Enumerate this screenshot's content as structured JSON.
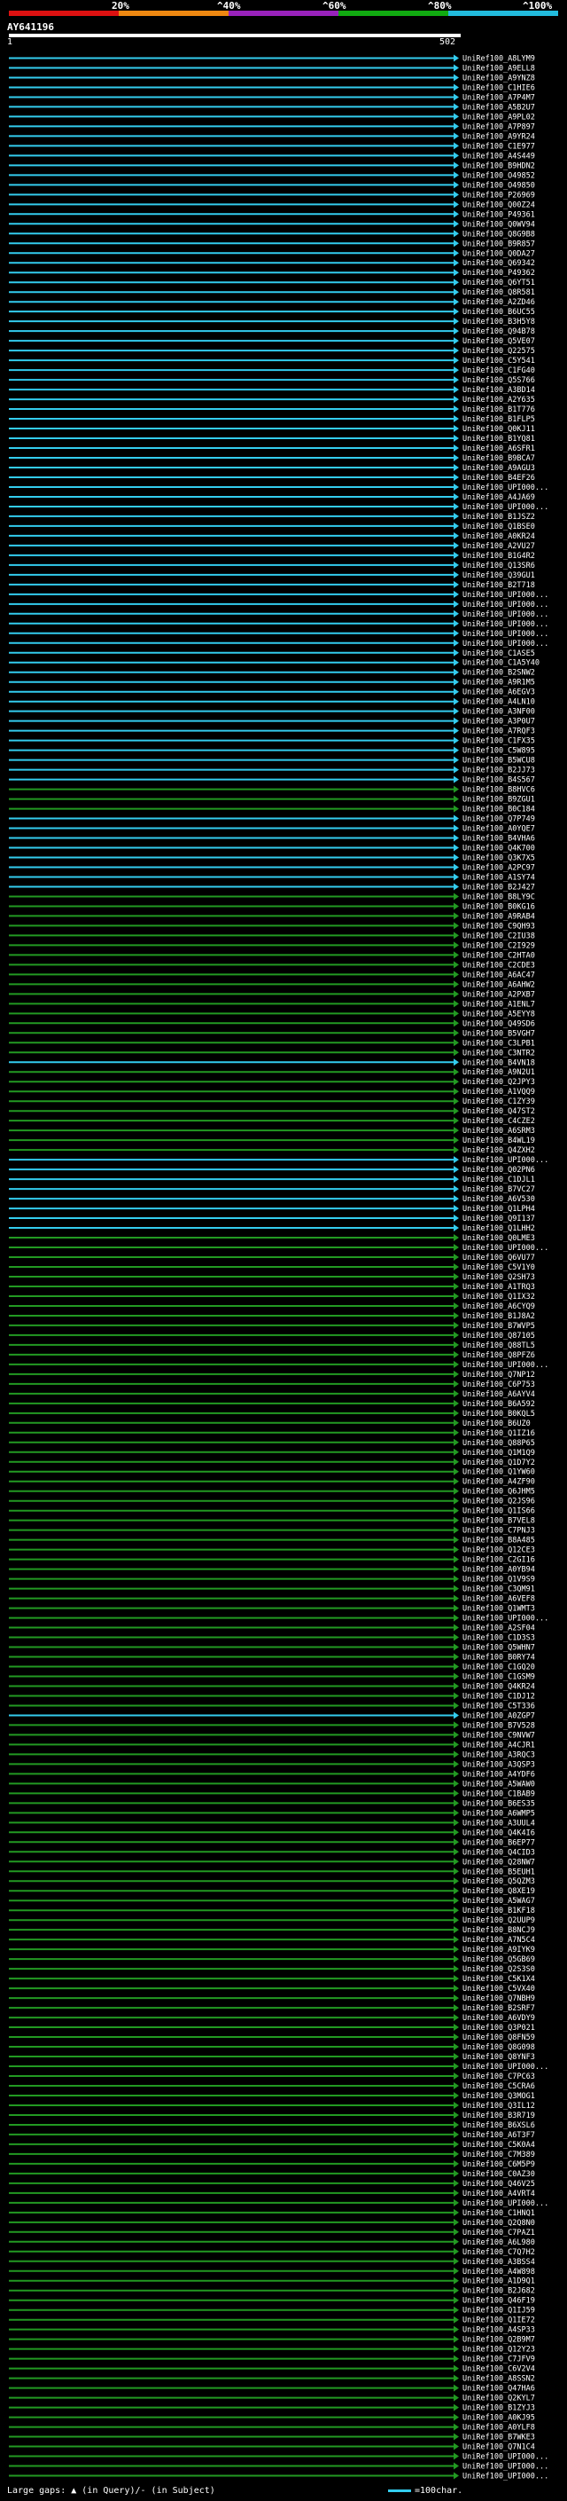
{
  "scale": {
    "labels": [
      "20%",
      "^40%",
      "^60%",
      "^80%",
      "^100%"
    ],
    "colors": [
      "#dd1111",
      "#ee8811",
      "#9922bb",
      "#11aa11",
      "#22bbdd"
    ]
  },
  "query": {
    "name": "AY641196",
    "start": "1",
    "end": "502"
  },
  "colors": {
    "high": "#33ccee",
    "mid": "#229922",
    "axis": "#ffffff"
  },
  "hits": [
    {
      "name": "UniRef100_A8LYM9",
      "cls": "high"
    },
    {
      "name": "UniRef100_A9ELL8",
      "cls": "high"
    },
    {
      "name": "UniRef100_A9YNZ8",
      "cls": "high"
    },
    {
      "name": "UniRef100_C1HIE6",
      "cls": "high"
    },
    {
      "name": "UniRef100_A7P4M7",
      "cls": "high"
    },
    {
      "name": "UniRef100_A5B2U7",
      "cls": "high"
    },
    {
      "name": "UniRef100_A9PL02",
      "cls": "high"
    },
    {
      "name": "UniRef100_A7P897",
      "cls": "high"
    },
    {
      "name": "UniRef100_A9YR24",
      "cls": "high"
    },
    {
      "name": "UniRef100_C1E977",
      "cls": "high"
    },
    {
      "name": "UniRef100_A4S449",
      "cls": "high"
    },
    {
      "name": "UniRef100_B9HDN2",
      "cls": "high"
    },
    {
      "name": "UniRef100_O49852",
      "cls": "high"
    },
    {
      "name": "UniRef100_O49850",
      "cls": "high"
    },
    {
      "name": "UniRef100_P26969",
      "cls": "high"
    },
    {
      "name": "UniRef100_Q00Z24",
      "cls": "high"
    },
    {
      "name": "UniRef100_P49361",
      "cls": "high"
    },
    {
      "name": "UniRef100_Q0WV94",
      "cls": "high"
    },
    {
      "name": "UniRef100_Q8G9B8",
      "cls": "high"
    },
    {
      "name": "UniRef100_B9R857",
      "cls": "high"
    },
    {
      "name": "UniRef100_Q0DA27",
      "cls": "high"
    },
    {
      "name": "UniRef100_Q69342",
      "cls": "high"
    },
    {
      "name": "UniRef100_P49362",
      "cls": "high"
    },
    {
      "name": "UniRef100_Q6YT51",
      "cls": "high"
    },
    {
      "name": "UniRef100_Q8R581",
      "cls": "high"
    },
    {
      "name": "UniRef100_A2ZD46",
      "cls": "high"
    },
    {
      "name": "UniRef100_B6UC55",
      "cls": "high"
    },
    {
      "name": "UniRef100_B3H5Y8",
      "cls": "high"
    },
    {
      "name": "UniRef100_Q94B78",
      "cls": "high"
    },
    {
      "name": "UniRef100_Q5VE07",
      "cls": "high"
    },
    {
      "name": "UniRef100_Q22575",
      "cls": "high"
    },
    {
      "name": "UniRef100_C5Y541",
      "cls": "high"
    },
    {
      "name": "UniRef100_C1FG40",
      "cls": "high"
    },
    {
      "name": "UniRef100_Q5S766",
      "cls": "high"
    },
    {
      "name": "UniRef100_A3BD14",
      "cls": "high"
    },
    {
      "name": "UniRef100_A2Y635",
      "cls": "high"
    },
    {
      "name": "UniRef100_B1T776",
      "cls": "high"
    },
    {
      "name": "UniRef100_B1FLP5",
      "cls": "high"
    },
    {
      "name": "UniRef100_Q0KJ11",
      "cls": "high"
    },
    {
      "name": "UniRef100_B1YQ81",
      "cls": "high"
    },
    {
      "name": "UniRef100_A6SFR1",
      "cls": "high"
    },
    {
      "name": "UniRef100_B9BCA7",
      "cls": "high"
    },
    {
      "name": "UniRef100_A9AGU3",
      "cls": "high"
    },
    {
      "name": "UniRef100_B4EF26",
      "cls": "high"
    },
    {
      "name": "UniRef100_UPI000...",
      "cls": "high"
    },
    {
      "name": "UniRef100_A4JA69",
      "cls": "high"
    },
    {
      "name": "UniRef100_UPI000...",
      "cls": "high"
    },
    {
      "name": "UniRef100_B1JSZ2",
      "cls": "high"
    },
    {
      "name": "UniRef100_Q1BSE0",
      "cls": "high"
    },
    {
      "name": "UniRef100_A0KR24",
      "cls": "high"
    },
    {
      "name": "UniRef100_A2VU27",
      "cls": "high"
    },
    {
      "name": "UniRef100_B1G4R2",
      "cls": "high"
    },
    {
      "name": "UniRef100_Q13SR6",
      "cls": "high"
    },
    {
      "name": "UniRef100_Q39GU1",
      "cls": "high"
    },
    {
      "name": "UniRef100_B2T718",
      "cls": "high"
    },
    {
      "name": "UniRef100_UPI000...",
      "cls": "high"
    },
    {
      "name": "UniRef100_UPI000...",
      "cls": "high"
    },
    {
      "name": "UniRef100_UPI000...",
      "cls": "high"
    },
    {
      "name": "UniRef100_UPI000...",
      "cls": "high"
    },
    {
      "name": "UniRef100_UPI000...",
      "cls": "high"
    },
    {
      "name": "UniRef100_UPI000...",
      "cls": "high"
    },
    {
      "name": "UniRef100_C1ASE5",
      "cls": "high"
    },
    {
      "name": "UniRef100_C1A5Y40",
      "cls": "high"
    },
    {
      "name": "UniRef100_B2SNW2",
      "cls": "high"
    },
    {
      "name": "UniRef100_A9R1M5",
      "cls": "high"
    },
    {
      "name": "UniRef100_A6EGV3",
      "cls": "high"
    },
    {
      "name": "UniRef100_A4LN10",
      "cls": "high"
    },
    {
      "name": "UniRef100_A3NF00",
      "cls": "high"
    },
    {
      "name": "UniRef100_A3P0U7",
      "cls": "high"
    },
    {
      "name": "UniRef100_A7RQF3",
      "cls": "high"
    },
    {
      "name": "UniRef100_C1FX35",
      "cls": "high"
    },
    {
      "name": "UniRef100_C5W895",
      "cls": "high"
    },
    {
      "name": "UniRef100_B5WCU8",
      "cls": "high"
    },
    {
      "name": "UniRef100_B2JJ73",
      "cls": "high"
    },
    {
      "name": "UniRef100_B4S567",
      "cls": "high"
    },
    {
      "name": "UniRef100_B8HVC6",
      "cls": "mid"
    },
    {
      "name": "UniRef100_B9ZGU1",
      "cls": "mid"
    },
    {
      "name": "UniRef100_B0C184",
      "cls": "mid"
    },
    {
      "name": "UniRef100_Q7P749",
      "cls": "high"
    },
    {
      "name": "UniRef100_A0YQE7",
      "cls": "high"
    },
    {
      "name": "UniRef100_B4VHA6",
      "cls": "high"
    },
    {
      "name": "UniRef100_Q4K700",
      "cls": "high"
    },
    {
      "name": "UniRef100_Q3K7X5",
      "cls": "high"
    },
    {
      "name": "UniRef100_A2PC97",
      "cls": "high"
    },
    {
      "name": "UniRef100_A1SY74",
      "cls": "high"
    },
    {
      "name": "UniRef100_B2J427",
      "cls": "high"
    },
    {
      "name": "UniRef100_B8LY9C",
      "cls": "mid"
    },
    {
      "name": "UniRef100_B0KG16",
      "cls": "mid"
    },
    {
      "name": "UniRef100_A9RAB4",
      "cls": "mid"
    },
    {
      "name": "UniRef100_C9QH93",
      "cls": "mid"
    },
    {
      "name": "UniRef100_C2IU38",
      "cls": "mid"
    },
    {
      "name": "UniRef100_C2I929",
      "cls": "mid"
    },
    {
      "name": "UniRef100_C2HTA0",
      "cls": "mid"
    },
    {
      "name": "UniRef100_C2CDE3",
      "cls": "mid"
    },
    {
      "name": "UniRef100_A6AC47",
      "cls": "mid"
    },
    {
      "name": "UniRef100_A6AHW2",
      "cls": "mid"
    },
    {
      "name": "UniRef100_A2PXB7",
      "cls": "mid"
    },
    {
      "name": "UniRef100_A1ENL7",
      "cls": "mid"
    },
    {
      "name": "UniRef100_A5EYY8",
      "cls": "mid"
    },
    {
      "name": "UniRef100_Q49SD6",
      "cls": "mid"
    },
    {
      "name": "UniRef100_B5VGH7",
      "cls": "mid"
    },
    {
      "name": "UniRef100_C3LPB1",
      "cls": "mid"
    },
    {
      "name": "UniRef100_C3NTR2",
      "cls": "mid"
    },
    {
      "name": "UniRef100_B4VN18",
      "cls": "high"
    },
    {
      "name": "UniRef100_A9N2U1",
      "cls": "mid"
    },
    {
      "name": "UniRef100_Q2JPY3",
      "cls": "mid"
    },
    {
      "name": "UniRef100_A1VQQ9",
      "cls": "mid"
    },
    {
      "name": "UniRef100_C1ZY39",
      "cls": "mid"
    },
    {
      "name": "UniRef100_Q47ST2",
      "cls": "mid"
    },
    {
      "name": "UniRef100_C4CZE2",
      "cls": "mid"
    },
    {
      "name": "UniRef100_A6SRM3",
      "cls": "mid"
    },
    {
      "name": "UniRef100_B4WL19",
      "cls": "mid"
    },
    {
      "name": "UniRef100_Q4ZXH2",
      "cls": "mid"
    },
    {
      "name": "UniRef100_UPI000...",
      "cls": "high"
    },
    {
      "name": "UniRef100_Q02PN6",
      "cls": "high"
    },
    {
      "name": "UniRef100_C1DJL1",
      "cls": "high"
    },
    {
      "name": "UniRef100_B7VC27",
      "cls": "high"
    },
    {
      "name": "UniRef100_A6V530",
      "cls": "high"
    },
    {
      "name": "UniRef100_Q1LPH4",
      "cls": "high"
    },
    {
      "name": "UniRef100_Q9I137",
      "cls": "high"
    },
    {
      "name": "UniRef100_Q1LHH2",
      "cls": "high"
    },
    {
      "name": "UniRef100_Q0LME3",
      "cls": "mid"
    },
    {
      "name": "UniRef100_UPI000...",
      "cls": "mid"
    },
    {
      "name": "UniRef100_Q6VU77",
      "cls": "mid"
    },
    {
      "name": "UniRef100_C5V1Y0",
      "cls": "mid"
    },
    {
      "name": "UniRef100_Q2SH73",
      "cls": "mid"
    },
    {
      "name": "UniRef100_A1TRQ3",
      "cls": "mid"
    },
    {
      "name": "UniRef100_Q1IX32",
      "cls": "mid"
    },
    {
      "name": "UniRef100_A6CYQ9",
      "cls": "mid"
    },
    {
      "name": "UniRef100_B1J8A2",
      "cls": "mid"
    },
    {
      "name": "UniRef100_B7WVP5",
      "cls": "mid"
    },
    {
      "name": "UniRef100_Q87105",
      "cls": "mid"
    },
    {
      "name": "UniRef100_Q88TL5",
      "cls": "mid"
    },
    {
      "name": "UniRef100_Q8PFZ6",
      "cls": "mid"
    },
    {
      "name": "UniRef100_UPI000...",
      "cls": "mid"
    },
    {
      "name": "UniRef100_Q7NP12",
      "cls": "mid"
    },
    {
      "name": "UniRef100_C6P753",
      "cls": "mid"
    },
    {
      "name": "UniRef100_A6AYV4",
      "cls": "mid"
    },
    {
      "name": "UniRef100_B6A592",
      "cls": "mid"
    },
    {
      "name": "UniRef100_B0KQL5",
      "cls": "mid"
    },
    {
      "name": "UniRef100_B6UZ0",
      "cls": "mid"
    },
    {
      "name": "UniRef100_Q1IZ16",
      "cls": "mid"
    },
    {
      "name": "UniRef100_Q88P65",
      "cls": "mid"
    },
    {
      "name": "UniRef100_Q1M1Q9",
      "cls": "mid"
    },
    {
      "name": "UniRef100_Q1D7Y2",
      "cls": "mid"
    },
    {
      "name": "UniRef100_Q1YW60",
      "cls": "mid"
    },
    {
      "name": "UniRef100_A4ZF90",
      "cls": "mid"
    },
    {
      "name": "UniRef100_Q6JHM5",
      "cls": "mid"
    },
    {
      "name": "UniRef100_Q2JS96",
      "cls": "mid"
    },
    {
      "name": "UniRef100_Q1IS66",
      "cls": "mid"
    },
    {
      "name": "UniRef100_B7VEL8",
      "cls": "mid"
    },
    {
      "name": "UniRef100_C7PNJ3",
      "cls": "mid"
    },
    {
      "name": "UniRef100_B8A485",
      "cls": "mid"
    },
    {
      "name": "UniRef100_Q12CE3",
      "cls": "mid"
    },
    {
      "name": "UniRef100_C2GI16",
      "cls": "mid"
    },
    {
      "name": "UniRef100_A0YB94",
      "cls": "mid"
    },
    {
      "name": "UniRef100_Q1V9S9",
      "cls": "mid"
    },
    {
      "name": "UniRef100_C3QM91",
      "cls": "mid"
    },
    {
      "name": "UniRef100_A6VEF8",
      "cls": "mid"
    },
    {
      "name": "UniRef100_Q1WMT3",
      "cls": "mid"
    },
    {
      "name": "UniRef100_UPI000...",
      "cls": "mid"
    },
    {
      "name": "UniRef100_A2SF04",
      "cls": "mid"
    },
    {
      "name": "UniRef100_C1D3S3",
      "cls": "mid"
    },
    {
      "name": "UniRef100_Q5WHN7",
      "cls": "mid"
    },
    {
      "name": "UniRef100_B0RY74",
      "cls": "mid"
    },
    {
      "name": "UniRef100_C1GQ20",
      "cls": "mid"
    },
    {
      "name": "UniRef100_C1GSM9",
      "cls": "mid"
    },
    {
      "name": "UniRef100_Q4KR24",
      "cls": "mid"
    },
    {
      "name": "UniRef100_C1DJ12",
      "cls": "mid"
    },
    {
      "name": "UniRef100_C5T336",
      "cls": "mid"
    },
    {
      "name": "UniRef100_A0ZGP7",
      "cls": "high"
    },
    {
      "name": "UniRef100_B7V528",
      "cls": "mid"
    },
    {
      "name": "UniRef100_C9NVW7",
      "cls": "mid"
    },
    {
      "name": "UniRef100_A4CJR1",
      "cls": "mid"
    },
    {
      "name": "UniRef100_A3RQC3",
      "cls": "mid"
    },
    {
      "name": "UniRef100_A3QSP3",
      "cls": "mid"
    },
    {
      "name": "UniRef100_A4YDF6",
      "cls": "mid"
    },
    {
      "name": "UniRef100_A5WAW0",
      "cls": "mid"
    },
    {
      "name": "UniRef100_C1BAB9",
      "cls": "mid"
    },
    {
      "name": "UniRef100_B6ES35",
      "cls": "mid"
    },
    {
      "name": "UniRef100_A6WMP5",
      "cls": "mid"
    },
    {
      "name": "UniRef100_A3UUL4",
      "cls": "mid"
    },
    {
      "name": "UniRef100_Q4K4I6",
      "cls": "mid"
    },
    {
      "name": "UniRef100_B6EP77",
      "cls": "mid"
    },
    {
      "name": "UniRef100_Q4CID3",
      "cls": "mid"
    },
    {
      "name": "UniRef100_Q28NW7",
      "cls": "mid"
    },
    {
      "name": "UniRef100_B5EUH1",
      "cls": "mid"
    },
    {
      "name": "UniRef100_Q5QZM3",
      "cls": "mid"
    },
    {
      "name": "UniRef100_Q8XE19",
      "cls": "mid"
    },
    {
      "name": "UniRef100_A5WAG7",
      "cls": "mid"
    },
    {
      "name": "UniRef100_B1KF18",
      "cls": "mid"
    },
    {
      "name": "UniRef100_Q2UUP9",
      "cls": "mid"
    },
    {
      "name": "UniRef100_B8NCJ9",
      "cls": "mid"
    },
    {
      "name": "UniRef100_A7N5C4",
      "cls": "mid"
    },
    {
      "name": "UniRef100_A9IYK9",
      "cls": "mid"
    },
    {
      "name": "UniRef100_Q5GB69",
      "cls": "mid"
    },
    {
      "name": "UniRef100_Q2S3S0",
      "cls": "mid"
    },
    {
      "name": "UniRef100_C5K1X4",
      "cls": "mid"
    },
    {
      "name": "UniRef100_C5VX40",
      "cls": "mid"
    },
    {
      "name": "UniRef100_Q7NBH9",
      "cls": "mid"
    },
    {
      "name": "UniRef100_B2SRF7",
      "cls": "mid"
    },
    {
      "name": "UniRef100_A6VDY9",
      "cls": "mid"
    },
    {
      "name": "UniRef100_Q3P021",
      "cls": "mid"
    },
    {
      "name": "UniRef100_Q8FN59",
      "cls": "mid"
    },
    {
      "name": "UniRef100_Q8G098",
      "cls": "mid"
    },
    {
      "name": "UniRef100_Q8YNF3",
      "cls": "mid"
    },
    {
      "name": "UniRef100_UPI000...",
      "cls": "mid"
    },
    {
      "name": "UniRef100_C7PC63",
      "cls": "mid"
    },
    {
      "name": "UniRef100_C5CRA6",
      "cls": "mid"
    },
    {
      "name": "UniRef100_Q3MOG1",
      "cls": "mid"
    },
    {
      "name": "UniRef100_Q3IL12",
      "cls": "mid"
    },
    {
      "name": "UniRef100_B3R719",
      "cls": "mid"
    },
    {
      "name": "UniRef100_B6XSL6",
      "cls": "mid"
    },
    {
      "name": "UniRef100_A6T3F7",
      "cls": "mid"
    },
    {
      "name": "UniRef100_C5K0A4",
      "cls": "mid"
    },
    {
      "name": "UniRef100_C7M389",
      "cls": "mid"
    },
    {
      "name": "UniRef100_C6M5P9",
      "cls": "mid"
    },
    {
      "name": "UniRef100_C0AZ30",
      "cls": "mid"
    },
    {
      "name": "UniRef100_Q46V25",
      "cls": "mid"
    },
    {
      "name": "UniRef100_A4VRT4",
      "cls": "mid"
    },
    {
      "name": "UniRef100_UPI000...",
      "cls": "mid"
    },
    {
      "name": "UniRef100_C1HNQ1",
      "cls": "mid"
    },
    {
      "name": "UniRef100_Q2Q8N0",
      "cls": "mid"
    },
    {
      "name": "UniRef100_C7PAZ1",
      "cls": "mid"
    },
    {
      "name": "UniRef100_A6L980",
      "cls": "mid"
    },
    {
      "name": "UniRef100_C7Q7H2",
      "cls": "mid"
    },
    {
      "name": "UniRef100_A3BSS4",
      "cls": "mid"
    },
    {
      "name": "UniRef100_A4W898",
      "cls": "mid"
    },
    {
      "name": "UniRef100_A1D9Q1",
      "cls": "mid"
    },
    {
      "name": "UniRef100_B2J682",
      "cls": "mid"
    },
    {
      "name": "UniRef100_Q46F19",
      "cls": "mid"
    },
    {
      "name": "UniRef100_Q1IJ59",
      "cls": "mid"
    },
    {
      "name": "UniRef100_Q1IE72",
      "cls": "mid"
    },
    {
      "name": "UniRef100_A4SP33",
      "cls": "mid"
    },
    {
      "name": "UniRef100_Q2B9M7",
      "cls": "mid"
    },
    {
      "name": "UniRef100_Q12Y23",
      "cls": "mid"
    },
    {
      "name": "UniRef100_C7JFV9",
      "cls": "mid"
    },
    {
      "name": "UniRef100_C6V2V4",
      "cls": "mid"
    },
    {
      "name": "UniRef100_A8SSN2",
      "cls": "mid"
    },
    {
      "name": "UniRef100_Q47HA6",
      "cls": "mid"
    },
    {
      "name": "UniRef100_Q2KYL7",
      "cls": "mid"
    },
    {
      "name": "UniRef100_B1ZYJ3",
      "cls": "mid"
    },
    {
      "name": "UniRef100_A0KJ95",
      "cls": "mid"
    },
    {
      "name": "UniRef100_A0YLF8",
      "cls": "mid"
    },
    {
      "name": "UniRef100_B7WKE3",
      "cls": "mid"
    },
    {
      "name": "UniRef100_Q7N1C4",
      "cls": "mid"
    },
    {
      "name": "UniRef100_UPI000...",
      "cls": "mid"
    },
    {
      "name": "UniRef100_UPI000...",
      "cls": "mid"
    },
    {
      "name": "UniRef100_UPI000...",
      "cls": "mid"
    }
  ],
  "footer": {
    "large_gaps": "Large gaps: ▲ (in Query)/- (in Subject)",
    "scale_note": "=100char."
  }
}
